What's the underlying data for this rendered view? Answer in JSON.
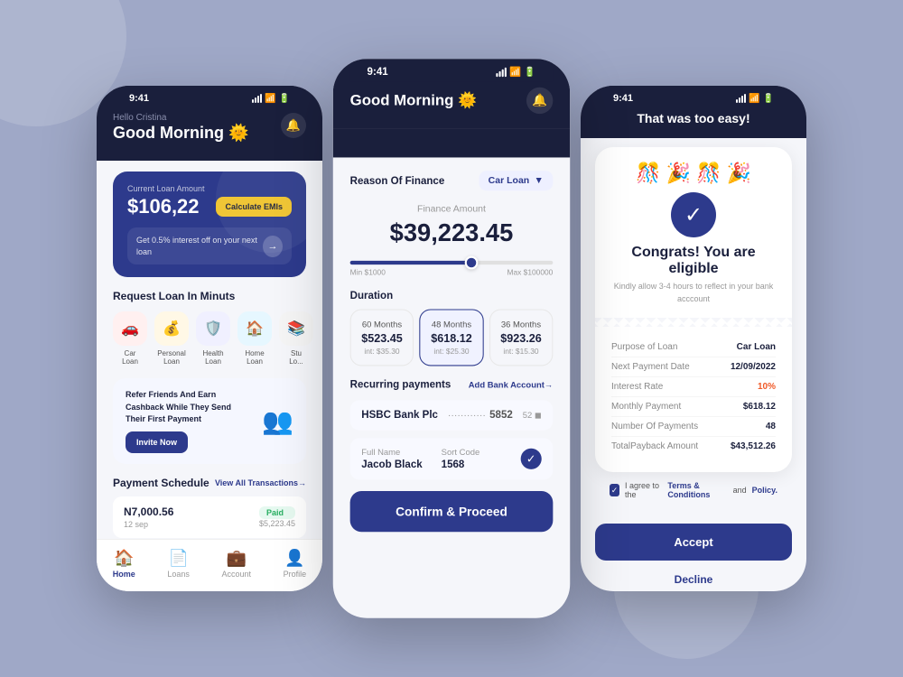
{
  "background": "#9fa8c7",
  "phone1": {
    "status": {
      "time": "9:41",
      "battery": "100%"
    },
    "header": {
      "greeting_sub": "Hello Cristina",
      "greeting_main": "Good Morning 🌞"
    },
    "loan_card": {
      "label": "Current Loan Amount",
      "amount": "$106,22",
      "cta": "Calculate EMIs",
      "promo": "Get 0.5% interest off on your next loan"
    },
    "section_title": "Request Loan In Minuts",
    "loan_types": [
      {
        "label": "Car\nLoan",
        "icon": "🚗",
        "bg": "icon-car"
      },
      {
        "label": "Personal\nLoan",
        "icon": "💰",
        "bg": "icon-personal"
      },
      {
        "label": "Health\nLoan",
        "icon": "🛡️",
        "bg": "icon-health"
      },
      {
        "label": "Home\nLoan",
        "icon": "🏠",
        "bg": "icon-home"
      },
      {
        "label": "Stu\nLo...",
        "icon": "📚",
        "bg": "icon-more"
      }
    ],
    "referral": {
      "text": "Refer Friends And Earn Cashback While They Send Their First Payment",
      "cta": "Invite Now"
    },
    "payment_schedule": {
      "title": "Payment Schedule",
      "view_all": "View All Transactions→",
      "amount": "N7,000.56",
      "date": "12 sep",
      "status": "Paid",
      "sub_amount": "$5,223.45"
    },
    "nav": {
      "items": [
        {
          "icon": "🏠",
          "label": "Home",
          "active": true
        },
        {
          "icon": "📄",
          "label": "Loans",
          "active": false
        },
        {
          "icon": "👤",
          "label": "Account",
          "active": false
        },
        {
          "icon": "👤",
          "label": "Profile",
          "active": false
        }
      ]
    }
  },
  "phone2": {
    "status": {
      "time": "9:41"
    },
    "header": {
      "greeting_main": "Good Morning 🌞"
    },
    "reason_label": "Reason Of Finance",
    "reason_value": "Car Loan",
    "finance_label": "Finance Amount",
    "finance_amount": "$39,223.45",
    "slider": {
      "min": "Min $1000",
      "max": "Max $100000",
      "fill_percent": 60
    },
    "duration_title": "Duration",
    "duration_cards": [
      {
        "months": "60 Months",
        "amount": "$523.45",
        "int": "int: $35.30",
        "active": false
      },
      {
        "months": "48 Months",
        "amount": "$618.12",
        "int": "int: $25.30",
        "active": true
      },
      {
        "months": "36 Months",
        "amount": "$923.26",
        "int": "int: $15.30",
        "active": false
      }
    ],
    "recurring_title": "Recurring payments",
    "add_bank": "Add Bank Account→",
    "bank_name": "HSBC Bank Plc",
    "bank_dots": "············",
    "bank_last": "5852",
    "bank_right": "52 ◼",
    "full_name_label": "Full Name",
    "full_name": "Jacob Black",
    "sort_code_label": "Sort Code",
    "sort_code": "1568",
    "confirm_btn": "Confirm & Proceed"
  },
  "phone3": {
    "status": {
      "time": "9:41"
    },
    "header_title": "That was too easy!",
    "congrats_title": "Congrats! You are eligible",
    "congrats_sub": "Kindly allow 3-4 hours to reflect in your\nbank acccount",
    "details": [
      {
        "key": "Purpose of Loan",
        "value": "Car Loan",
        "highlight": false
      },
      {
        "key": "Next Payment Date",
        "value": "12/09/2022",
        "highlight": false
      },
      {
        "key": "Interest Rate",
        "value": "10%",
        "highlight": true
      },
      {
        "key": "Monthly Payment",
        "value": "$618.12",
        "highlight": false
      },
      {
        "key": "Number Of Payments",
        "value": "48",
        "highlight": false
      },
      {
        "key": "TotalPayback Amount",
        "value": "$43,512.26",
        "highlight": false
      }
    ],
    "terms_text": "I agree to the",
    "terms_link1": "Terms & Conditions",
    "terms_and": "and",
    "terms_link2": "Policy.",
    "accept_btn": "Accept",
    "decline_btn": "Decline"
  }
}
